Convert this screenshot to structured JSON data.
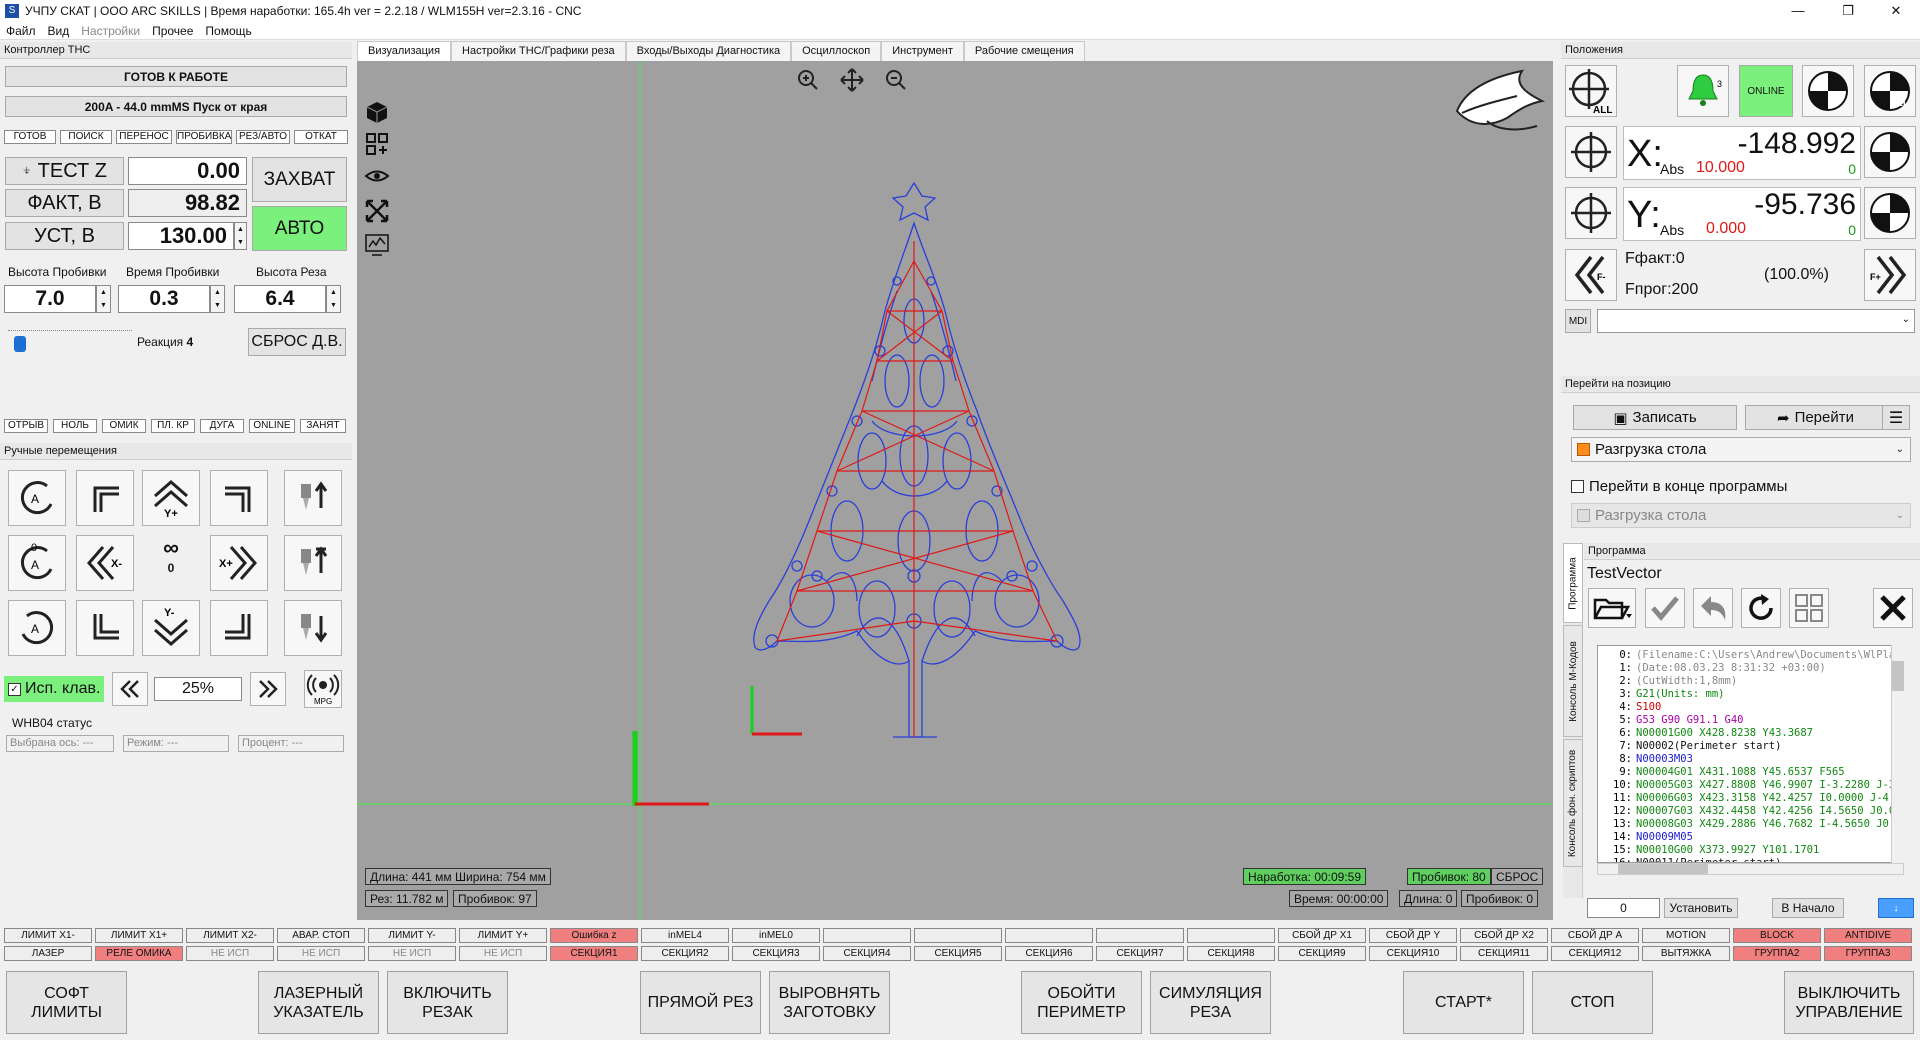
{
  "window": {
    "title": "УЧПУ СКАТ | ООО ARC SKILLS | Время наработки:  165.4h ver = 2.2.18 / WLM155H ver=2.3.16 - CNC",
    "app_icon": "S",
    "minimize": "—",
    "maximize": "❐",
    "close": "✕"
  },
  "menu": [
    "Файл",
    "Вид",
    "Настройки",
    "Прочее",
    "Помощь"
  ],
  "thc": {
    "header": "Контроллер ТНС",
    "status": "ГОТОВ К РАБОТЕ",
    "mode_line": "200A -  44.0 mmMS Пуск от края",
    "state_tags": [
      "ГОТОВ",
      "ПОИСК",
      "ПЕРЕНОС",
      "ПРОБИВКА",
      "РЕЗ/АВТО",
      "ОТКАТ"
    ],
    "test_z": "ТЕСТ Z",
    "test_z_val": "0.00",
    "fact_label": "ФАКТ, В",
    "fact_val": "98.82",
    "set_label": "УСТ, В",
    "set_val": "130.00",
    "capture": "ЗАХВАТ",
    "auto": "АВТО",
    "pierce_height_label": "Высота Пробивки",
    "pierce_height": "7.0",
    "pierce_time_label": "Время Пробивки",
    "pierce_time": "0.3",
    "cut_height_label": "Высота Реза",
    "cut_height": "6.4",
    "reaction_label": "Реакция",
    "reaction": "4",
    "reset": "СБРОС Д.В.",
    "flags": [
      "ОТРЫВ",
      "НОЛЬ",
      "ОМИК",
      "ПЛ. КР",
      "ДУГА",
      "ONLINE",
      "ЗАНЯТ"
    ]
  },
  "jog": {
    "header": "Ручные перемещения",
    "inf": "∞",
    "zero": "0",
    "use_keys": "Исп. клав.",
    "speed": "25%",
    "mpg": "MPG",
    "y_plus": "Y+",
    "y_minus": "Y-",
    "x_plus": "X+",
    "x_minus": "X-",
    "a_label": "A",
    "whb_header": "WHB04 статус",
    "axis": "Выбрана ось: ---",
    "mode": "Режим: ---",
    "percent": "Процент: ---"
  },
  "tabs": [
    "Визуализация",
    "Настройки ТНС/Графики реза",
    "Входы/Выходы Диагностика",
    "Осциллоскоп",
    "Инструмент",
    "Рабочие смещения"
  ],
  "viewport": {
    "size": "Длина: 441 мм Ширина: 754 мм",
    "cut": "Рез: 11.782 м",
    "pierces": "Пробивок: 97",
    "runtime": "Наработка: 00:09:59",
    "pierces2": "Пробивок: 80",
    "reset": "СБРОС",
    "time": "Время: 00:00:00",
    "length": "Длина: 0",
    "pierces3": "Пробивок: 0"
  },
  "position": {
    "header": "Положения",
    "bell_count": "3",
    "online": "ONLINE",
    "all": "ALL",
    "z": "Z",
    "x_label": "X:",
    "x_val": "-148.992",
    "x_abs": "10.000",
    "x_sub": "0",
    "y_label": "Y:",
    "y_val": "-95.736",
    "y_abs": "0.000",
    "y_sub": "0",
    "abs": "Abs",
    "f_fact": "Fфакт:0",
    "f_prog": "Fпрог:200",
    "f_pct": "(100.0%)",
    "f_minus": "F-",
    "f_plus": "F+",
    "mdi": "MDI"
  },
  "goto": {
    "header": "Перейти на позицию",
    "save": "Записать",
    "go": "Перейти",
    "preset": "Разгрузка стола",
    "at_end": "Перейти в конце программы",
    "preset2": "Разгрузка стола"
  },
  "program": {
    "header": "Программа",
    "name": "TestVector",
    "side_tabs": [
      "Программа",
      "Консоль М-Кодов",
      "Консоль фон. скриптов"
    ],
    "line_input": "0",
    "set": "Установить",
    "to_start": "В Начало",
    "lines": [
      {
        "n": "0:",
        "t": "(Filename:C:\\Users\\Andrew\\Documents\\WlPlasma\\pu"
      },
      {
        "n": "1:",
        "t": "(Date:08.03.23 8:31:32 +03:00)"
      },
      {
        "n": "2:",
        "t": "(CutWidth:1,8mm)"
      },
      {
        "n": "3:",
        "t": "G21(Units: mm)"
      },
      {
        "n": "4:",
        "t": "S100"
      },
      {
        "n": "5:",
        "t": "G53 G90 G91.1 G40"
      },
      {
        "n": "6:",
        "t": "N00001G00 X428.8238 Y43.3687"
      },
      {
        "n": "7:",
        "t": "N00002(Perimeter start)"
      },
      {
        "n": "8:",
        "t": "N00003M03"
      },
      {
        "n": "9:",
        "t": "N00004G01 X431.1088 Y45.6537 F565"
      },
      {
        "n": "10:",
        "t": "N00005G03 X427.8808 Y46.9907 I-3.2280 J-3.3"
      },
      {
        "n": "11:",
        "t": "N00006G03 X423.3158 Y42.4257 I0.0000 J-4.5"
      },
      {
        "n": "12:",
        "t": "N00007G03 X432.4458 Y42.4256 I4.5650 J0.00"
      },
      {
        "n": "13:",
        "t": "N00008G03 X429.2886 Y46.7682 I-4.5650 J0.00"
      },
      {
        "n": "14:",
        "t": "N00009M05"
      },
      {
        "n": "15:",
        "t": "N00010G00 X373.9927 Y101.1701"
      },
      {
        "n": "16:",
        "t": "N00011(Perimeter start)"
      }
    ]
  },
  "io_row1": [
    "ЛИМИТ X1-",
    "ЛИМИТ X1+",
    "ЛИМИТ X2-",
    "АВАР. СТОП",
    "ЛИМИТ Y-",
    "ЛИМИТ Y+",
    "Ошибка z",
    "inMEL4",
    "inMEL0",
    "",
    "",
    "",
    "",
    "",
    "СБОЙ ДР X1",
    "СБОЙ ДР Y",
    "СБОЙ ДР X2",
    "СБОЙ ДР A",
    "MOTION",
    "BLOCK",
    "ANTIDIVE"
  ],
  "io_row2": [
    "ЛАЗЕР",
    "РЕЛЕ ОМИКА",
    "НЕ ИСП",
    "НЕ ИСП",
    "НЕ ИСП",
    "НЕ ИСП",
    "СЕКЦИЯ1",
    "СЕКЦИЯ2",
    "СЕКЦИЯ3",
    "СЕКЦИЯ4",
    "СЕКЦИЯ5",
    "СЕКЦИЯ6",
    "СЕКЦИЯ7",
    "СЕКЦИЯ8",
    "СЕКЦИЯ9",
    "СЕКЦИЯ10",
    "СЕКЦИЯ11",
    "СЕКЦИЯ12",
    "ВЫТЯЖКА",
    "ГРУППА2",
    "ГРУППА3"
  ],
  "bottom": {
    "soft": "СОФТ ЛИМИТЫ",
    "laser": "ЛАЗЕРНЫЙ УКАЗАТЕЛЬ",
    "torch": "ВКЛЮЧИТЬ РЕЗАК",
    "straight": "ПРЯМОЙ РЕЗ",
    "align": "ВЫРОВНЯТЬ ЗАГОТОВКУ",
    "perimeter": "ОБОЙТИ ПЕРИМЕТР",
    "sim": "СИМУЛЯЦИЯ РЕЗА",
    "start": "СТАРТ*",
    "stop": "СТОП",
    "off": "ВЫКЛЮЧИТЬ УПРАВЛЕНИЕ"
  },
  "colors": {
    "green": "#7cf07c",
    "red": "#f08080",
    "viewport": "#a0a0a0",
    "path_blue": "#2a3fd8",
    "path_red": "#e01818"
  }
}
